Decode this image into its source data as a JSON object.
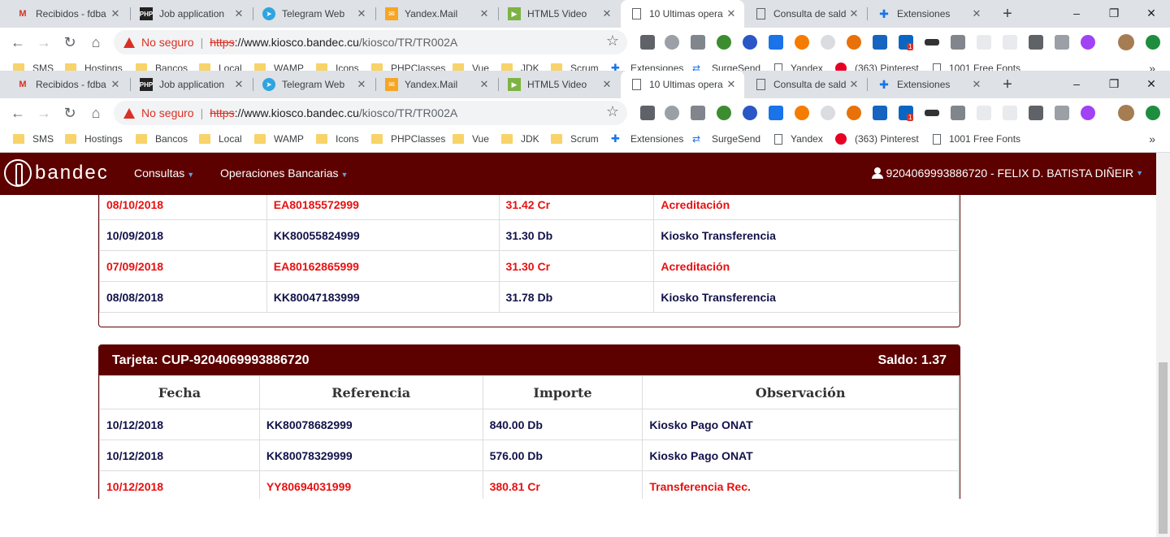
{
  "browser": {
    "tabs": [
      {
        "title": "Recibidos - fdba",
        "icon": "gmail-icon"
      },
      {
        "title": "Job application",
        "icon": "php-icon"
      },
      {
        "title": "Telegram Web",
        "icon": "telegram-icon"
      },
      {
        "title": "Yandex.Mail",
        "icon": "yandex-mail-icon"
      },
      {
        "title": "HTML5 Video",
        "icon": "html5-video-icon"
      },
      {
        "title": "10 Ultimas opera",
        "icon": "page-icon",
        "active": true
      },
      {
        "title": "Consulta de sald",
        "icon": "page-icon"
      },
      {
        "title": "Extensiones",
        "icon": "puzzle-icon"
      }
    ],
    "security_label": "No seguro",
    "url_scheme": "https",
    "url_host": "://www.kiosco.bandec.cu",
    "url_path": "/kiosco/TR/TR002A",
    "bookmarks": [
      "SMS",
      "Hostings",
      "Bancos",
      "Local",
      "WAMP",
      "Icons",
      "PHPClasses",
      "Vue",
      "JDK",
      "Scrum",
      "Extensiones",
      "SurgeSend",
      "Yandex",
      "(363) Pinterest",
      "1001 Free Fonts"
    ],
    "bookmarks_more": "»",
    "linkedin_badge": "1"
  },
  "navbar": {
    "brand": "bandec",
    "menu_consultas": "Consultas",
    "menu_operaciones": "Operaciones Bancarias",
    "user": "9204069993886720 - FELIX D. BATISTA DIÑEIR"
  },
  "table1": {
    "rows": [
      {
        "fecha": "08/10/2018",
        "referencia": "EA80185572999",
        "importe": "31.42 Cr",
        "observacion": "Acreditación",
        "red": true
      },
      {
        "fecha": "10/09/2018",
        "referencia": "KK80055824999",
        "importe": "31.30 Db",
        "observacion": "Kiosko Transferencia",
        "red": false
      },
      {
        "fecha": "07/09/2018",
        "referencia": "EA80162865999",
        "importe": "31.30 Cr",
        "observacion": "Acreditación",
        "red": true
      },
      {
        "fecha": "08/08/2018",
        "referencia": "KK80047183999",
        "importe": "31.78 Db",
        "observacion": "Kiosko Transferencia",
        "red": false
      }
    ]
  },
  "card2": {
    "title": "Tarjeta: CUP-9204069993886720",
    "saldo": "Saldo: 1.37",
    "headers": {
      "fecha": "Fecha",
      "referencia": "Referencia",
      "importe": "Importe",
      "observacion": "Observación"
    },
    "rows": [
      {
        "fecha": "10/12/2018",
        "referencia": "KK80078682999",
        "importe": "840.00 Db",
        "observacion": "Kiosko Pago ONAT",
        "red": false
      },
      {
        "fecha": "10/12/2018",
        "referencia": "KK80078329999",
        "importe": "576.00 Db",
        "observacion": "Kiosko Pago ONAT",
        "red": false
      },
      {
        "fecha": "10/12/2018",
        "referencia": "YY80694031999",
        "importe": "380.81 Cr",
        "observacion": "Transferencia Rec.",
        "red": true
      }
    ]
  },
  "colors": {
    "brand": "#5c0000",
    "credit_text": "#e81010",
    "debit_text": "#12124a"
  }
}
